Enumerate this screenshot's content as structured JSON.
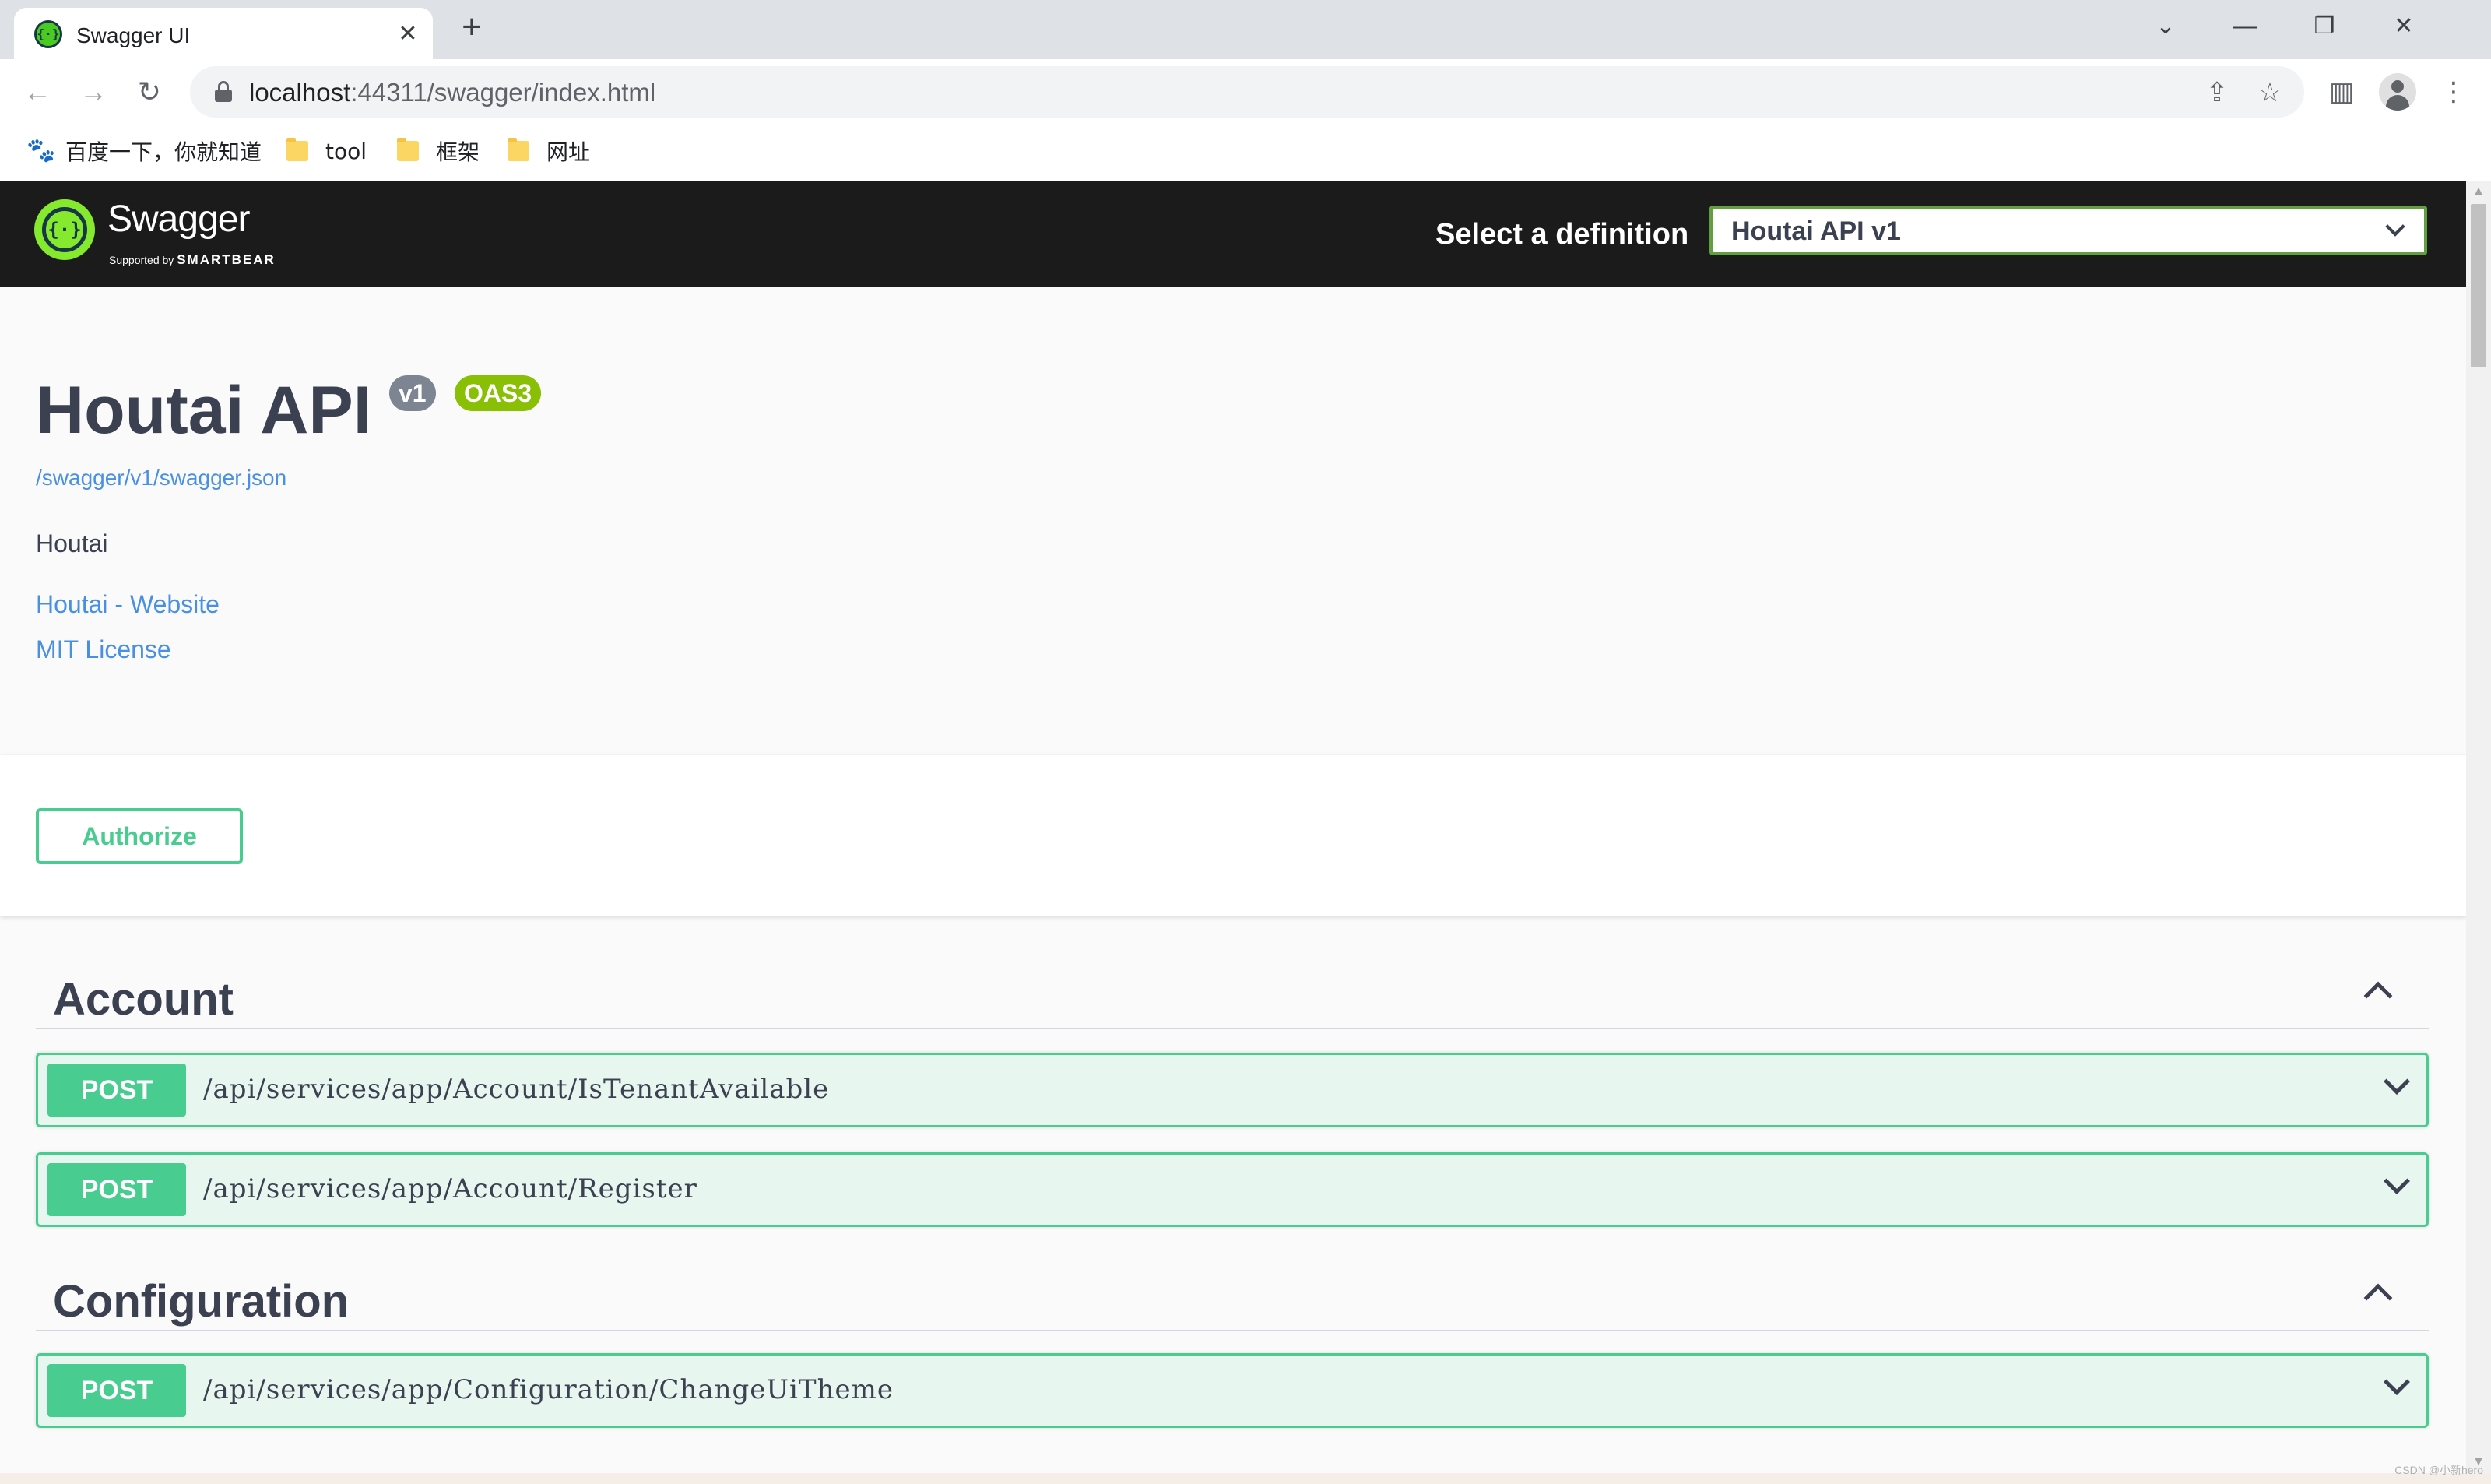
{
  "browser": {
    "tab": {
      "title": "Swagger UI"
    },
    "address": {
      "host": "localhost",
      "rest": ":44311/swagger/index.html"
    },
    "bookmarks": [
      {
        "label": "百度一下，你就知道",
        "icon": "baidu-paw-icon"
      },
      {
        "label": "tool",
        "icon": "folder-icon"
      },
      {
        "label": "框架",
        "icon": "folder-icon"
      },
      {
        "label": "网址",
        "icon": "folder-icon"
      }
    ]
  },
  "swagger": {
    "logo": {
      "name": "Swagger",
      "supported_by": "Supported by",
      "brand": "SMARTBEAR"
    },
    "definition": {
      "label": "Select a definition",
      "selected": "Houtai API v1"
    },
    "info": {
      "title": "Houtai API",
      "version_badge": "v1",
      "oas_badge": "OAS3",
      "spec_url": "/swagger/v1/swagger.json",
      "description": "Houtai",
      "website_link": "Houtai - Website",
      "license_link": "MIT License"
    },
    "authorize_label": "Authorize",
    "tags": [
      {
        "name": "Account",
        "operations": [
          {
            "method": "POST",
            "path": "/api/services/app/Account/IsTenantAvailable"
          },
          {
            "method": "POST",
            "path": "/api/services/app/Account/Register"
          }
        ]
      },
      {
        "name": "Configuration",
        "operations": [
          {
            "method": "POST",
            "path": "/api/services/app/Configuration/ChangeUiTheme"
          }
        ]
      }
    ]
  },
  "watermark": "CSDN @小新hero",
  "colors": {
    "post": "#49cc90",
    "link": "#4990e2",
    "topbar": "#1b1b1b",
    "text": "#3b4151"
  }
}
